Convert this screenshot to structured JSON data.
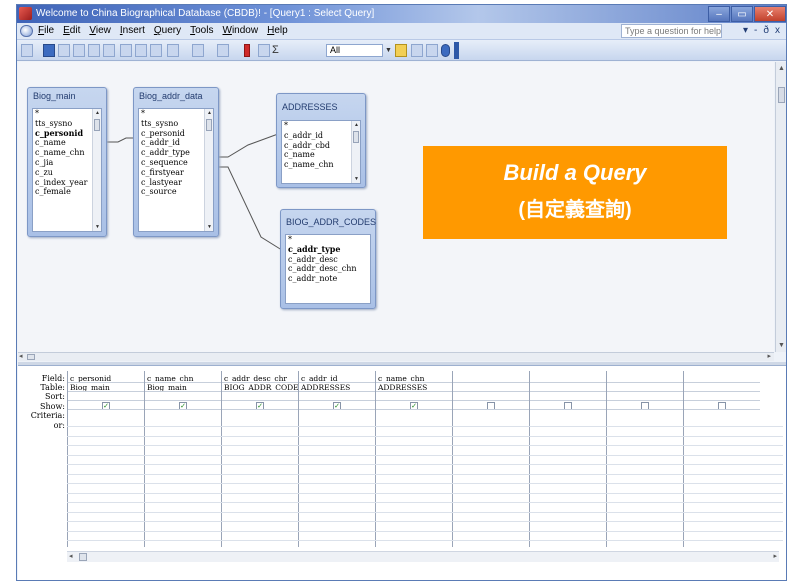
{
  "window": {
    "title": "Welcome to China Biographical Database (CBDB)! - [Query1 : Select Query]"
  },
  "menu": {
    "items": [
      "File",
      "Edit",
      "View",
      "Insert",
      "Query",
      "Tools",
      "Window",
      "Help"
    ],
    "help_placeholder": "Type a question for help",
    "right_controls": [
      "▾",
      "-",
      "ð",
      "x"
    ]
  },
  "toolbar": {
    "all_value": "All",
    "sigma": "Σ",
    "bang": "!"
  },
  "tables": [
    {
      "title": "Biog_main",
      "fields": [
        "*",
        "tts_sysno",
        "c_personid",
        "c_name",
        "c_name_chn",
        "c_jia",
        "c_zu",
        "c_index_year",
        "c_female"
      ],
      "bold": [
        "c_personid"
      ]
    },
    {
      "title": "Biog_addr_data",
      "fields": [
        "*",
        "tts_sysno",
        "c_personid",
        "c_addr_id",
        "c_addr_type",
        "c_sequence",
        "c_firstyear",
        "c_lastyear",
        "c_source"
      ],
      "bold": []
    },
    {
      "title": "ADDRESSES",
      "fields": [
        "*",
        "c_addr_id",
        "c_addr_cbd",
        "c_name",
        "c_name_chn"
      ],
      "bold": []
    },
    {
      "title": "BIOG_ADDR_CODES",
      "fields": [
        "*",
        "c_addr_type",
        "c_addr_desc",
        "c_addr_desc_chn",
        "c_addr_note"
      ],
      "bold": [
        "c_addr_type"
      ]
    }
  ],
  "callout": {
    "title": "Build a Query",
    "subtitle": "(自定義查詢)",
    "color": "#ff9900"
  },
  "grid": {
    "row_labels": [
      "Field:",
      "Table:",
      "Sort:",
      "Show:",
      "Criteria:",
      "or:"
    ],
    "columns": [
      {
        "field": "c_personid",
        "table": "Biog_main",
        "show": true
      },
      {
        "field": "c_name_chn",
        "table": "Biog_main",
        "show": true
      },
      {
        "field": "c_addr_desc_chr",
        "table": "BIOG_ADDR_CODES",
        "show": true
      },
      {
        "field": "c_addr_id",
        "table": "ADDRESSES",
        "show": true
      },
      {
        "field": "c_name_chn",
        "table": "ADDRESSES",
        "show": true
      },
      {
        "field": "",
        "table": "",
        "show": false
      },
      {
        "field": "",
        "table": "",
        "show": false
      },
      {
        "field": "",
        "table": "",
        "show": false
      },
      {
        "field": "",
        "table": "",
        "show": false
      }
    ]
  }
}
